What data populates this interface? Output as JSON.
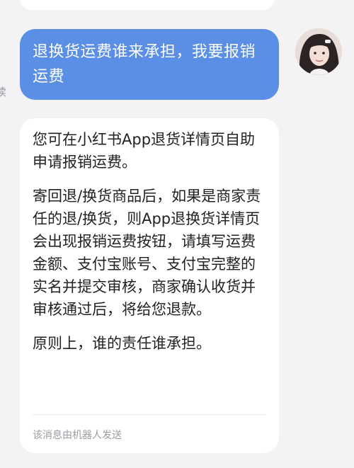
{
  "chat": {
    "read_mark": "读",
    "user_message": "退换货运费谁来承担，我要报销运费",
    "bot_message": {
      "paragraph_1": "您可在小红书App退货详情页自助申请报销运费。",
      "paragraph_2": "寄回退/换货商品后，如果是商家责任的退/换货，则App退换货详情页会出现报销运费按钮，请填写运费金额、支付宝账号、支付宝完整的实名并提交审核，商家确认收货并审核通过后，将给您退款。",
      "paragraph_3": "原则上，谁的责任谁承担。"
    },
    "bot_footer": "该消息由机器人发送"
  },
  "colors": {
    "background": "#f3f3f5",
    "user_bubble": "#5b8fe6",
    "bot_bubble": "#ffffff",
    "footer_text": "#9b9ba1"
  }
}
